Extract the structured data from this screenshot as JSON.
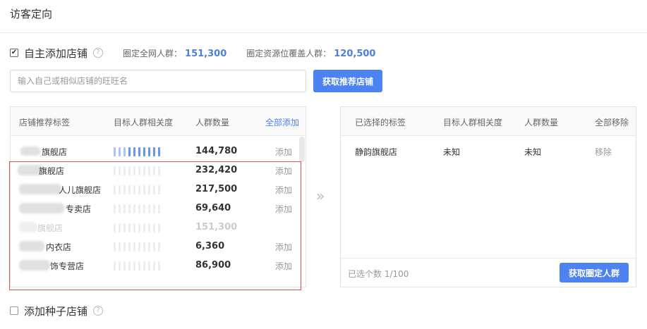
{
  "page": {
    "title": "访客定向"
  },
  "self_add": {
    "checked": "✔",
    "label": "自主添加店铺",
    "help": "?",
    "stats": [
      {
        "label": "圈定全网人群：",
        "value": "151,300"
      },
      {
        "label": "圈定资源位覆盖人群：",
        "value": "120,500"
      }
    ]
  },
  "search": {
    "placeholder": "输入自己或相似店铺的旺旺名",
    "value": ""
  },
  "recommend_button": "获取推荐店铺",
  "left_panel": {
    "columns": {
      "tag": "店铺推荐标签",
      "relevance": "目标人群相关度",
      "count": "人群数量",
      "add_all": "全部添加"
    },
    "rows": [
      {
        "name": "旗舰店",
        "count": "144,780",
        "action": "添加",
        "relevance_active": true
      },
      {
        "name": "旗舰店",
        "count": "232,420",
        "action": "添加",
        "relevance_active": false
      },
      {
        "name": "人儿旗舰店",
        "count": "217,500",
        "action": "添加",
        "relevance_active": false
      },
      {
        "name": "专卖店",
        "count": "69,640",
        "action": "添加",
        "relevance_active": false
      },
      {
        "name": "旗舰店",
        "count": "151,300",
        "action": "",
        "relevance_active": false,
        "disabled": true
      },
      {
        "name": "内衣店",
        "count": "6,360",
        "action": "添加",
        "relevance_active": false
      },
      {
        "name": "饰专营店",
        "count": "86,900",
        "action": "添加",
        "relevance_active": false
      }
    ]
  },
  "transfer_icon": "»",
  "right_panel": {
    "columns": {
      "tag": "已选择的标签",
      "relevance": "目标人群相关度",
      "count": "人群数量",
      "remove_all": "全部移除"
    },
    "rows": [
      {
        "name": "静韵旗舰店",
        "relevance": "未知",
        "count": "未知",
        "action": "移除"
      }
    ],
    "selected_count": "已选个数 1/100",
    "crowd_button": "获取圈定人群"
  },
  "seed_add": {
    "label": "添加种子店铺",
    "help": "?"
  },
  "colors": {
    "accent": "#4c82f2",
    "value_blue": "#4e7fd6",
    "highlight_border": "#d9534f"
  }
}
